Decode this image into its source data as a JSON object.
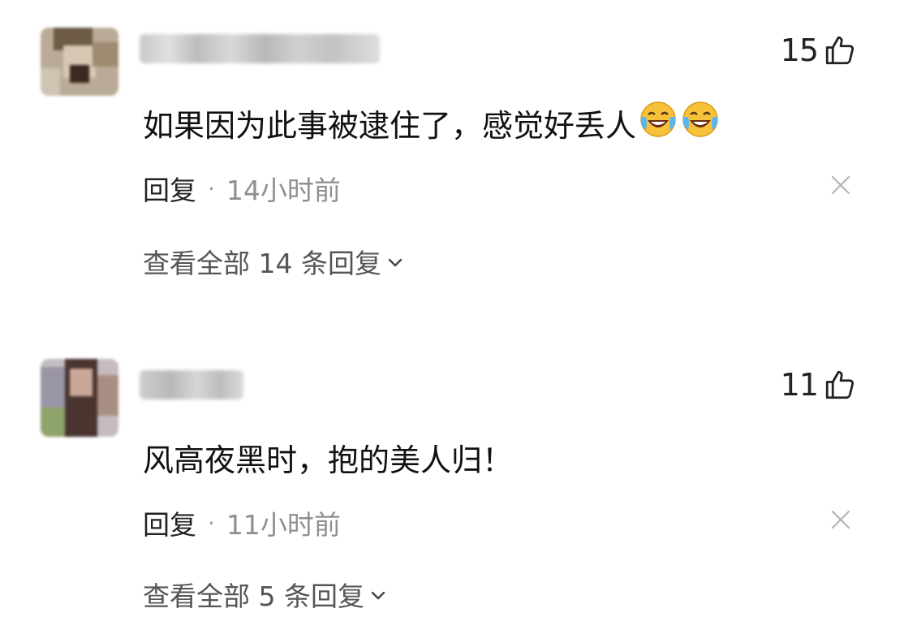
{
  "comments": [
    {
      "likes": "15",
      "text": "如果因为此事被逮住了，感觉好丢人",
      "emojis": [
        "laugh-cry-emoji",
        "laugh-cry-emoji"
      ],
      "reply_label": "回复",
      "separator": "·",
      "time": "14小时前",
      "view_replies": "查看全部 14 条回复"
    },
    {
      "likes": "11",
      "text": "风高夜黑时，抱的美人归！",
      "emojis": [],
      "reply_label": "回复",
      "separator": "·",
      "time": "11小时前",
      "view_replies": "查看全部 5 条回复"
    }
  ],
  "icons": {
    "like": "thumbs-up-icon",
    "close": "close-icon",
    "expand": "chevron-down-icon"
  },
  "colors": {
    "text": "#111111",
    "muted": "#8f8f8f",
    "link": "#555555"
  }
}
